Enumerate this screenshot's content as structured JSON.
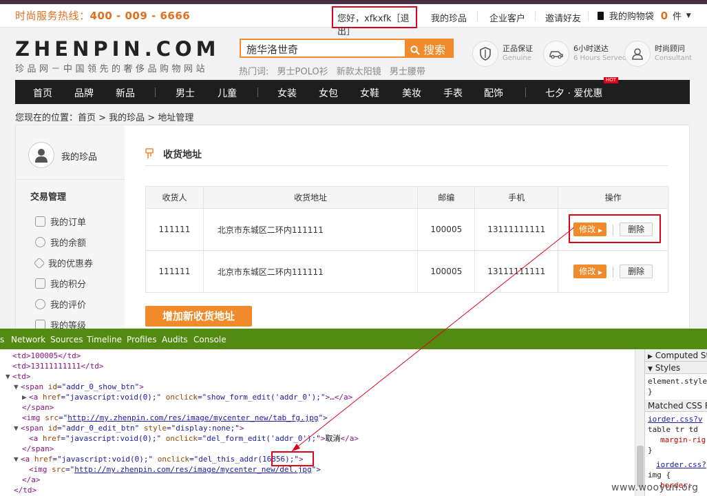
{
  "topbar": {
    "hotline_label": "时尚服务热线：",
    "hotline_number": "400 - 009 - 6666",
    "greeting": "您好，xfkxfk［退出］",
    "links": [
      "我的珍品",
      "企业客户",
      "邀请好友"
    ],
    "cart_label": "我的购物袋",
    "cart_count": "0",
    "cart_unit": "件"
  },
  "header": {
    "logo": "ZHENPIN.COM",
    "logo_sub": "珍品网－中国领先的奢侈品购物网站",
    "search_value": "施华洛世奇",
    "search_button": "搜索",
    "hot_label": "热门词:",
    "hot_words": [
      "男士POLO衫",
      "新款太阳镜",
      "男士腰带"
    ],
    "services": [
      {
        "title": "正品保证",
        "sub": "Genuine",
        "icon": "shield-icon"
      },
      {
        "title": "6小时送达",
        "sub": "6 Hours Served",
        "icon": "car-icon"
      },
      {
        "title": "时尚顾问",
        "sub": "Consultant",
        "icon": "person-icon"
      }
    ]
  },
  "nav": {
    "items": [
      "首页",
      "品牌",
      "新品",
      "男士",
      "儿童",
      "女装",
      "女包",
      "女鞋",
      "美妆",
      "手表",
      "配饰",
      "七夕 · 爱优惠"
    ],
    "hot_badge": "HOT"
  },
  "breadcrumb": "您现在的位置：首页 > 我的珍品 > 地址管理",
  "sidebar": {
    "title": "我的珍品",
    "section": "交易管理",
    "items": [
      "我的订单",
      "我的余额",
      "我的优惠券",
      "我的积分",
      "我的评价",
      "我的等级"
    ]
  },
  "main": {
    "title": "收货地址",
    "headers": [
      "收货人",
      "收货地址",
      "邮编",
      "手机",
      "操作"
    ],
    "rows": [
      {
        "name": "111111",
        "address": "北京市东城区二环内111111",
        "zip": "100005",
        "phone": "13111111111",
        "edit": "修改",
        "delete": "删除"
      },
      {
        "name": "111111",
        "address": "北京市东城区二环内111111",
        "zip": "100005",
        "phone": "13111111111",
        "edit": "修改",
        "delete": "删除"
      }
    ],
    "add_button": "增加新收货地址"
  },
  "devtools": {
    "tabs": [
      "s",
      "Network",
      "Sources",
      "Timeline",
      "Profiles",
      "Audits",
      "Console"
    ],
    "code": {
      "l1": "<td>100005</td>",
      "l2": "<td>13111111111</td>",
      "l3": "<td>",
      "l4a": "<span ",
      "l4b": "id",
      "l4c": "=\"addr_0_show_btn\"",
      "l4d": ">",
      "l5a": "<a ",
      "l5b": "href",
      "l5c": "=\"javascript:void(0);\"",
      "l5d": " onclick",
      "l5e": "=\"show_form_edit('addr_0');\"",
      "l5f": ">…</a>",
      "l6": "</span>",
      "l7a": "<img ",
      "l7b": "src",
      "l7c": "=\"",
      "l7d": "http://my.zhenpin.com/res/image/mycenter_new/tab_fg.jpg",
      "l7e": "\">",
      "l8a": "<span ",
      "l8b": "id",
      "l8c": "=\"addr_0_edit_btn\"",
      "l8d": " style",
      "l8e": "=\"display:none;\"",
      "l8f": ">",
      "l9a": "<a ",
      "l9b": "href",
      "l9c": "=\"javascript:void(0);\"",
      "l9d": " onclick",
      "l9e": "=\"del_form_edit('addr_0');\"",
      "l9f": ">",
      "l9g": "取消",
      "l9h": "</a>",
      "l10": "</span>",
      "l11a": "<a ",
      "l11b": "href",
      "l11c": "=\"javascript:void(0);\"",
      "l11d": " onclick",
      "l11e": "=\"del_this_addr(16856);\"",
      "l11f": ">",
      "l12a": "<img ",
      "l12b": "src",
      "l12c": "=\"",
      "l12d": "http://my.zhenpin.com/res/image/mycenter_new/del.jpg",
      "l12e": "\">",
      "l13": "</a>",
      "l14": "</td>"
    },
    "side": {
      "computed": "Computed Sty",
      "styles": "Styles",
      "element_style": "element.style",
      "brace_close": "}",
      "matched": "Matched CSS Ru",
      "iorder1": "iorder.css?v",
      "rule1": "table tr td",
      "prop1": "margin-rig",
      "iorder2": "iorder.css?",
      "rule2": "img {",
      "prop2": "border:"
    }
  },
  "watermark": "www.wooyun.org",
  "colors": {
    "accent": "#f08a2a",
    "nav_bg": "#1e1e1e",
    "devtools_bar": "#528a12",
    "highlight": "#e0001a"
  }
}
